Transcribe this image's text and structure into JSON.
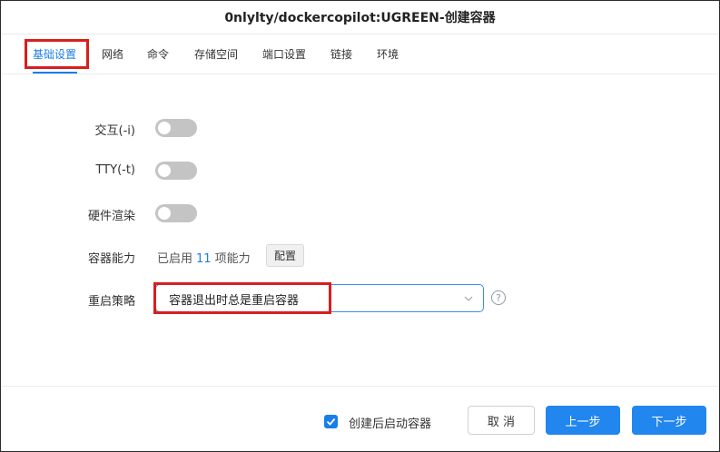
{
  "window": {
    "title": "0nlylty/dockercopilot:UGREEN-创建容器"
  },
  "tabs": [
    {
      "label": "基础设置",
      "active": true
    },
    {
      "label": "网络"
    },
    {
      "label": "命令"
    },
    {
      "label": "存储空间"
    },
    {
      "label": "端口设置"
    },
    {
      "label": "链接"
    },
    {
      "label": "环境"
    }
  ],
  "form": {
    "interactive": {
      "label": "交互(-i)",
      "enabled": false
    },
    "tty": {
      "label": "TTY(-t)",
      "enabled": false
    },
    "gpu": {
      "label": "硬件渲染",
      "enabled": false
    },
    "capabilities": {
      "label": "容器能力",
      "prefix": "已启用",
      "count": "11",
      "suffix": "项能力",
      "button": "配置"
    },
    "restart": {
      "label": "重启策略",
      "value": "容器退出时总是重启容器",
      "help_icon": "question-circle-icon"
    }
  },
  "footer": {
    "autostart_checked": true,
    "autostart_label": "创建后启动容器",
    "cancel_label": "取 消",
    "prev_label": "上一步",
    "next_label": "下一步"
  },
  "colors": {
    "accent": "#1a7ee8",
    "highlight": "#d81e1e",
    "toggle_off": "#c4c4c4"
  }
}
